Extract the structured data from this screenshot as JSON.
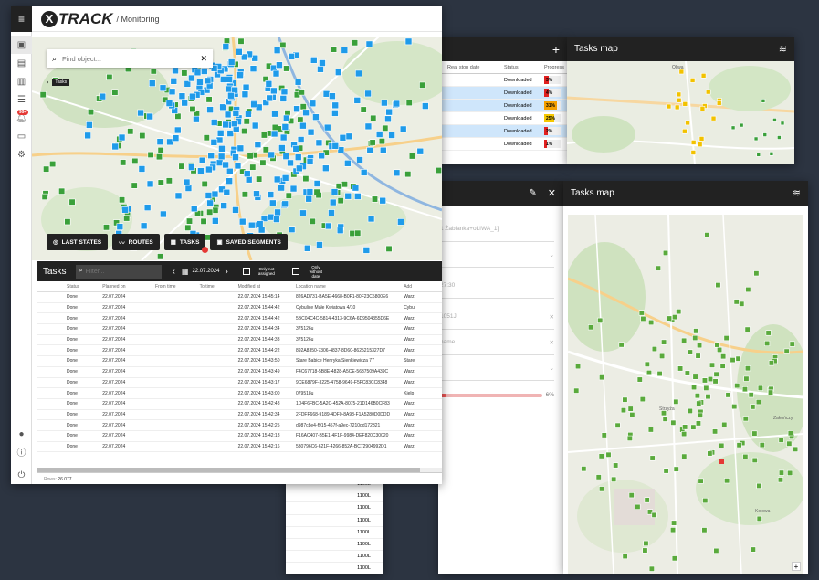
{
  "app": {
    "logo": "TRACK",
    "breadcrumb": "/ Monitoring",
    "notifications_badge": "99+"
  },
  "search": {
    "placeholder": "Find object..."
  },
  "map_tooltip": "Tasks",
  "map_buttons": {
    "last_states": "LAST STATES",
    "routes": "ROUTES",
    "tasks": "TASKS",
    "saved_segments": "SAVED SEGMENTS"
  },
  "tasks_panel": {
    "title": "Tasks",
    "filter_placeholder": "Filter...",
    "date": "22.07.2024",
    "only_not_assigned": "Only not assigned",
    "only_without_date": "Only without date",
    "columns": [
      "Status",
      "Planned on",
      "From time",
      "To time",
      "Modified at",
      "Location name",
      "Add"
    ],
    "rows": [
      {
        "status": "Done",
        "planned": "22.07.2024",
        "from": "",
        "to": "",
        "modified": "22.07.2024 15:45:14",
        "location": "826AD731-BA5E-4668-B0F1-80F23C5800E6",
        "add": "Warz"
      },
      {
        "status": "Done",
        "planned": "22.07.2024",
        "from": "",
        "to": "",
        "modified": "22.07.2024 15:44:42",
        "location": "Cybulice Małe Kwiatowa 4/10",
        "add": "Cybu"
      },
      {
        "status": "Done",
        "planned": "22.07.2024",
        "from": "",
        "to": "",
        "modified": "22.07.2024 15:44:42",
        "location": "5BC04C4C-5814-4313-9C6A-6D9504355D6E",
        "add": "Warz"
      },
      {
        "status": "Done",
        "planned": "22.07.2024",
        "from": "",
        "to": "",
        "modified": "22.07.2024 15:44:34",
        "location": "375126u",
        "add": "Warz"
      },
      {
        "status": "Done",
        "planned": "22.07.2024",
        "from": "",
        "to": "",
        "modified": "22.07.2024 15:44:33",
        "location": "375126u",
        "add": "Warz"
      },
      {
        "status": "Done",
        "planned": "22.07.2024",
        "from": "",
        "to": "",
        "modified": "22.07.2024 15:44:22",
        "location": "892A8350-7306-4837-8D60-8625215327D7",
        "add": "Warz"
      },
      {
        "status": "Done",
        "planned": "22.07.2024",
        "from": "",
        "to": "",
        "modified": "22.07.2024 15:43:50",
        "location": "Stare Babice Henryka Sienkiewicza 77",
        "add": "Stare"
      },
      {
        "status": "Done",
        "planned": "22.07.2024",
        "from": "",
        "to": "",
        "modified": "22.07.2024 15:43:49",
        "location": "F4C67718-5B8E-4828-A5CE-5637509A439C",
        "add": "Warz"
      },
      {
        "status": "Done",
        "planned": "22.07.2024",
        "from": "",
        "to": "",
        "modified": "22.07.2024 15:43:17",
        "location": "9CE6879F-3225-4758-9649-F5FC83CC8348",
        "add": "Warz"
      },
      {
        "status": "Done",
        "planned": "22.07.2024",
        "from": "",
        "to": "",
        "modified": "22.07.2024 15:43:00",
        "location": "079518u",
        "add": "Kielp"
      },
      {
        "status": "Done",
        "planned": "22.07.2024",
        "from": "",
        "to": "",
        "modified": "22.07.2024 15:42:48",
        "location": "1D4F6FBC-5A2C-452A-8075-21D146B0CF83",
        "add": "Warz"
      },
      {
        "status": "Done",
        "planned": "22.07.2024",
        "from": "",
        "to": "",
        "modified": "22.07.2024 15:42:34",
        "location": "2FDFF668-9189-4DF0-8A98-F1A5280D0DDD",
        "add": "Warz"
      },
      {
        "status": "Done",
        "planned": "22.07.2024",
        "from": "",
        "to": "",
        "modified": "22.07.2024 15:42:25",
        "location": "d987c8e4-f915-457f-a9ec-7210dd172321",
        "add": "Warz"
      },
      {
        "status": "Done",
        "planned": "22.07.2024",
        "from": "",
        "to": "",
        "modified": "22.07.2024 15:42:18",
        "location": "F16AC407-B5E1-4F1F-9984-DEF820C30020",
        "add": "Warz"
      },
      {
        "status": "Done",
        "planned": "22.07.2024",
        "from": "",
        "to": "",
        "modified": "22.07.2024 15:42:16",
        "location": "530796C6-621F-4266-852A-BC72904992D1",
        "add": "Warz"
      }
    ],
    "rows_label": "Rows:",
    "rows_count": "26.077"
  },
  "list_panel": {
    "columns": [
      "Real stop date",
      "Status",
      "Progress"
    ],
    "rows": [
      {
        "status": "Downloaded",
        "progress": "3%",
        "color": "#e02020",
        "selected": false,
        "fill": 0.25
      },
      {
        "status": "Downloaded",
        "progress": "4%",
        "color": "#e02020",
        "selected": true,
        "fill": 0.3
      },
      {
        "status": "Downloaded",
        "progress": "31%",
        "color": "#f5a000",
        "selected": true,
        "fill": 0.8
      },
      {
        "status": "Downloaded",
        "progress": "25%",
        "color": "#f5c800",
        "selected": false,
        "fill": 0.6
      },
      {
        "status": "Downloaded",
        "progress": "2%",
        "color": "#e02020",
        "selected": true,
        "fill": 0.2
      },
      {
        "status": "Downloaded",
        "progress": "1%",
        "color": "#e02020",
        "selected": false,
        "fill": 0.15
      }
    ]
  },
  "tasks_map_title": "Tasks map",
  "edit_panel": {
    "field1": "1 Żabianka+oLIWA_1]",
    "field3": "27:30",
    "field4": "1051J",
    "field5": "name",
    "progress": "6%"
  },
  "map_labels": {
    "kolowa": "Kolowa",
    "oliwa": "Oliwa",
    "zakonczy": "Zakończy",
    "strzyza": "Strzyża"
  },
  "bottom_list": {
    "values": [
      "1100L",
      "1100L",
      "1100L",
      "1100L",
      "1100L",
      "1100L",
      "1100L",
      "1100L"
    ]
  },
  "colors": {
    "accent": "#1f9bea",
    "green": "#3aa03a",
    "dark": "#222222",
    "selected": "#cfe6fb",
    "badge": "#e53935"
  }
}
